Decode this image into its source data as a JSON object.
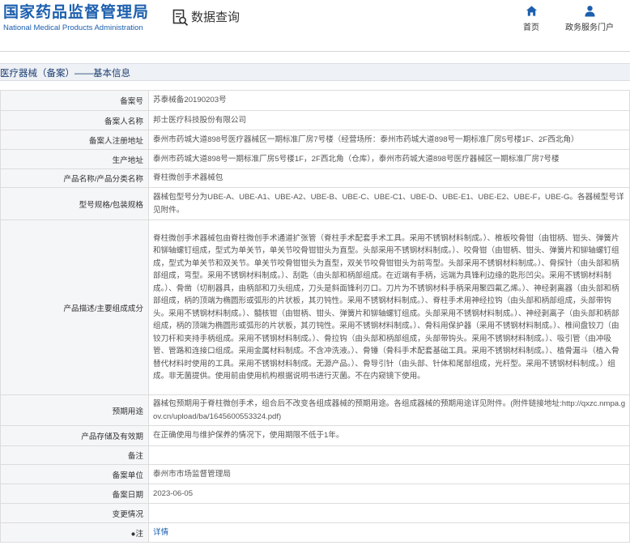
{
  "header": {
    "brand_cn": "国家药品监督管理局",
    "brand_en": "National Medical Products Administration",
    "query_label": "数据查询",
    "nav": [
      {
        "label": "首页",
        "icon": "home-icon"
      },
      {
        "label": "政务服务门户",
        "icon": "user-icon"
      }
    ]
  },
  "section": {
    "title": "医疗器械（备案）——基本信息"
  },
  "rows": [
    {
      "label": "备案号",
      "value": "苏泰械备20190203号"
    },
    {
      "label": "备案人名称",
      "value": "邦士医疗科技股份有限公司"
    },
    {
      "label": "备案人注册地址",
      "value": "泰州市药城大道898号医疗器械区一期标准厂房7号楼（经营场所：泰州市药城大道898号一期标准厂房5号楼1F、2F西北角）"
    },
    {
      "label": "生产地址",
      "value": "泰州市药城大道898号一期标准厂房5号楼1F，2F西北角（仓库），泰州市药城大道898号医疗器械区一期标准厂房7号楼"
    },
    {
      "label": "产品名称/产品分类名称",
      "value": "脊柱微创手术器械包"
    },
    {
      "label": "型号规格/包装规格",
      "value": "器械包型号分为UBE-A、UBE-A1、UBE-A2、UBE-B、UBE-C、UBE-C1、UBE-D、UBE-E1、UBE-E2、UBE-F，UBE-G。各器械型号详见附件。"
    },
    {
      "label": "产品描述/主要组成成分",
      "value": "脊柱微创手术器械包由脊柱微创手术通道扩张管（脊柱手术配套手术工具。采用不锈钢材料制成。）、椎板咬骨钳（由钳柄、钳头、弹簧片和铆轴螺钉组成，型式为单关节，单关节咬骨钳钳头为直型。头部采用不锈钢材料制成。）、咬骨钳（由钳柄、钳头、弹簧片和铆轴螺钉组成，型式为单关节和双关节。单关节咬骨钳钳头为直型，双关节咬骨钳钳头为前弯型。头部采用不锈钢材料制成。）、骨探针（由头部和柄部组成，弯型。采用不锈钢材料制成。）、刮匙（由头部和柄部组成。在近端有手柄，远端为具锋利边缘的匙形凹尖。采用不锈钢材料制成。）、骨凿（切削器具，由柄部和刀头组成，刀头是斜面锋利刃口。刀片为不锈钢材料手柄采用聚四氟乙烯。）、神经剥离器（由头部和柄部组成，柄的顶端为椭圆形或弧形的片状板，其刃钝性。采用不锈钢材料制成。）、脊柱手术用神经拉钩（由头部和柄部组成，头部带钩头。采用不锈钢材料制成。）、髓核钳（由钳柄、钳头、弹簧片和铆轴螺钉组成。头部采用不锈钢材料制成。）、神经剥离子（由头部和柄部组成，柄的顶端为椭圆形或弧形的片状板，其刃钝性。采用不锈钢材料制成。）、骨科用保护器（采用不锈钢材料制成。）、椎间盘铰刀（由铰刀杆和夹持手柄组成。采用不锈钢材料制成。）、骨拉钩（由头部和柄部组成，头部带钩头。采用不锈钢材料制成。）、吸引管（由冲吸管、管路和连接口组成。采用金属材料制成。不含冲洗液。）、骨锤（骨科手术配套基础工具。采用不锈钢材料制成。）、植骨漏斗（植入骨替代材料时使用的工具。采用不锈钢材料制成。无源产品。）、骨导引针（由头部、针体和尾部组成，光杆型。采用不锈钢材料制成。）组成。非无菌提供。使用前由使用机构根据说明书进行灭菌。不在内窥镜下使用。"
    },
    {
      "label": "预期用途",
      "value": "器械包预期用于脊柱微创手术，组合后不改变各组成器械的预期用途。各组成器械的预期用途详见附件。(附件链接地址:http://qxzc.nmpa.gov.cn/upload/ba/1645600553324.pdf)"
    },
    {
      "label": "产品存储及有效期",
      "value": "在正确使用与维护保养的情况下，使用期限不低于1年。"
    },
    {
      "label": "备注",
      "value": ""
    },
    {
      "label": "备案单位",
      "value": "泰州市市场监督管理局"
    },
    {
      "label": "备案日期",
      "value": "2023-06-05"
    },
    {
      "label": "变更情况",
      "value": ""
    },
    {
      "label": "●注",
      "value": "详情",
      "link": true
    }
  ]
}
